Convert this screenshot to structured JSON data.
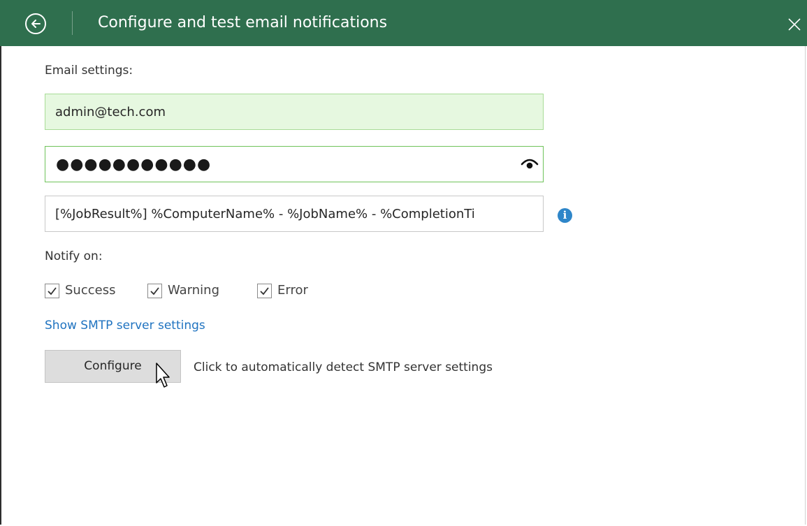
{
  "window": {
    "title": "Configure and test email notifications",
    "theme_color": "#2f6f4e"
  },
  "email_settings": {
    "label": "Email settings:",
    "email_value": "admin@tech.com",
    "password_masked": "●●●●●●●●●●●",
    "subject_value": "[%JobResult%] %ComputerName% - %JobName% - %CompletionTi"
  },
  "notify": {
    "label": "Notify on:",
    "options": [
      {
        "label": "Success",
        "checked": true
      },
      {
        "label": "Warning",
        "checked": true
      },
      {
        "label": "Error",
        "checked": true
      }
    ]
  },
  "smtp": {
    "show_link": "Show SMTP server settings",
    "configure_button": "Configure",
    "configure_hint": "Click to automatically detect SMTP server settings"
  },
  "icons": {
    "back": "back-arrow-icon",
    "close": "close-icon",
    "eye": "eye-icon",
    "info": "info-icon",
    "checkmark": "checkmark-icon",
    "cursor": "mouse-cursor-icon"
  },
  "colors": {
    "link": "#1f73c0",
    "valid_field_bg": "#e6f8e0",
    "focus_border": "#6fc35a",
    "info": "#2e86c9"
  }
}
